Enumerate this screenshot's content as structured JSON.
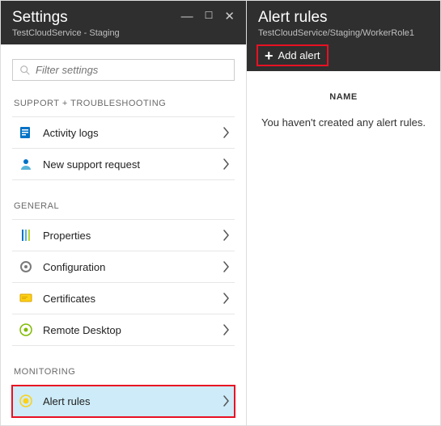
{
  "left": {
    "title": "Settings",
    "subtitle": "TestCloudService - Staging",
    "searchPlaceholder": "Filter settings",
    "sections": [
      {
        "label": "SUPPORT + TROUBLESHOOTING",
        "items": [
          {
            "id": "activity-logs",
            "label": "Activity logs",
            "icon": "log"
          },
          {
            "id": "new-support-request",
            "label": "New support request",
            "icon": "support"
          }
        ]
      },
      {
        "label": "GENERAL",
        "items": [
          {
            "id": "properties",
            "label": "Properties",
            "icon": "properties"
          },
          {
            "id": "configuration",
            "label": "Configuration",
            "icon": "config"
          },
          {
            "id": "certificates",
            "label": "Certificates",
            "icon": "cert"
          },
          {
            "id": "remote-desktop",
            "label": "Remote Desktop",
            "icon": "remote"
          }
        ]
      },
      {
        "label": "MONITORING",
        "items": [
          {
            "id": "alert-rules",
            "label": "Alert rules",
            "icon": "alert",
            "selected": true
          }
        ]
      }
    ]
  },
  "right": {
    "title": "Alert rules",
    "subtitle": "TestCloudService/Staging/WorkerRole1",
    "addAlert": "Add alert",
    "columnHeader": "NAME",
    "emptyMessage": "You haven't created any alert rules."
  }
}
